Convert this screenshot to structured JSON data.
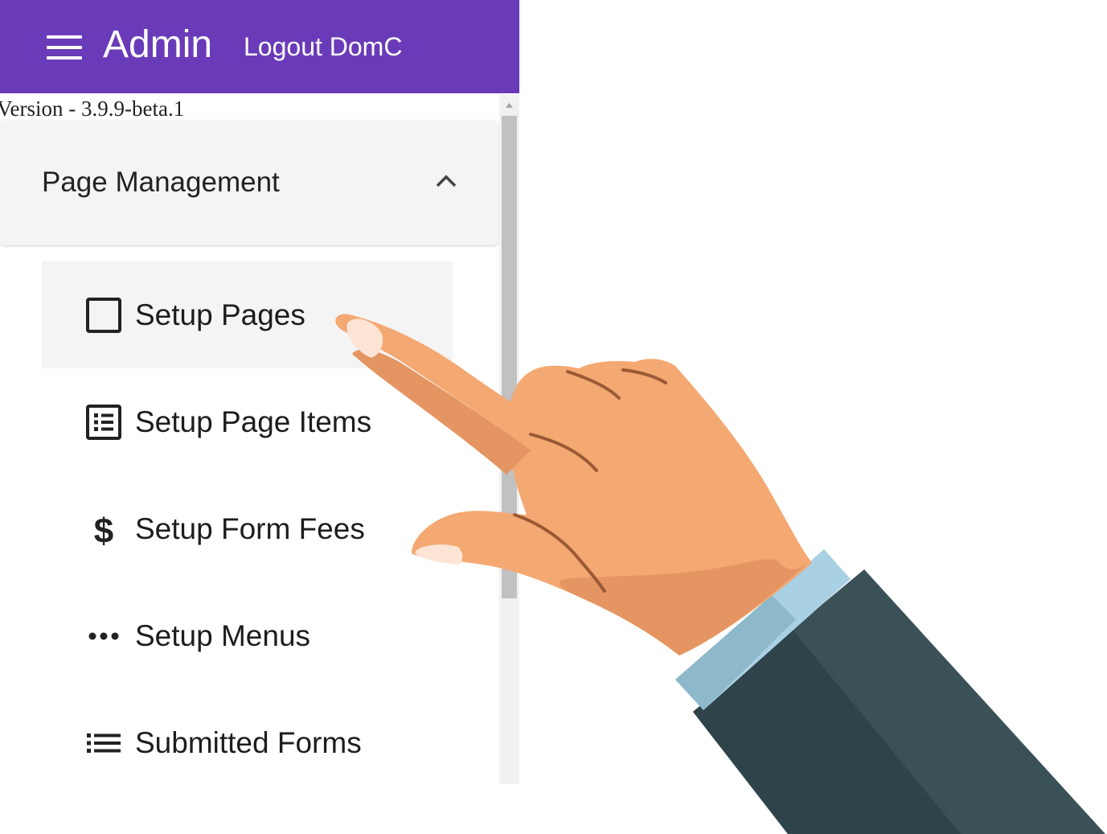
{
  "header": {
    "title": "Admin",
    "logout_label": "Logout DomC",
    "menu_icon": "hamburger-menu-icon"
  },
  "version_text": "Version - 3.9.9-beta.1",
  "nav": {
    "group_label": "Page Management",
    "group_expanded": true,
    "items": [
      {
        "label": "Setup Pages",
        "icon": "checkbox-square-icon",
        "active": true
      },
      {
        "label": "Setup Page Items",
        "icon": "list-box-icon",
        "active": false
      },
      {
        "label": "Setup Form Fees",
        "icon": "dollar-icon",
        "active": false
      },
      {
        "label": "Setup Menus",
        "icon": "more-horiz-icon",
        "active": false
      },
      {
        "label": "Submitted Forms",
        "icon": "list-icon",
        "active": false
      }
    ]
  },
  "colors": {
    "appbar": "#6a3bb8",
    "skin": "#f4a872",
    "cuff": "#a9d0e3",
    "sleeve": "#3a5157"
  }
}
